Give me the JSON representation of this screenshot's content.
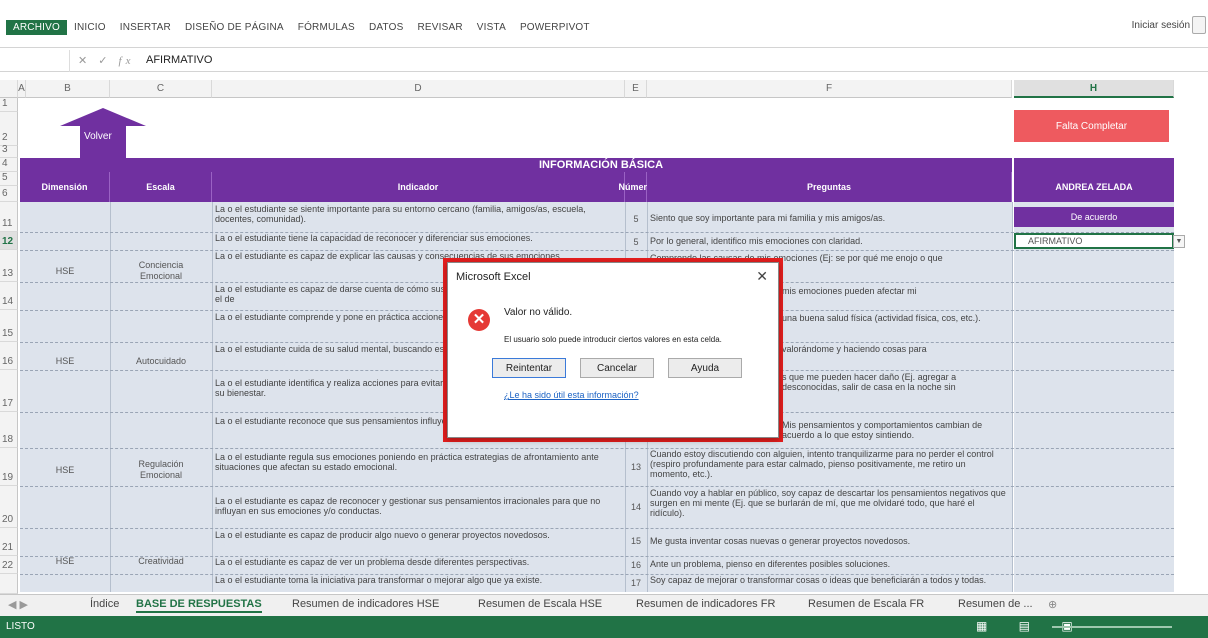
{
  "ribbon": {
    "tabs": [
      "ARCHIVO",
      "INICIO",
      "INSERTAR",
      "DISEÑO DE PÁGINA",
      "FÓRMULAS",
      "DATOS",
      "REVISAR",
      "VISTA",
      "POWERPIVOT"
    ],
    "signin": "Iniciar sesión"
  },
  "formula_bar": {
    "fx": "fx",
    "value": "AFIRMATIVO"
  },
  "columns": [
    "A",
    "B",
    "C",
    "D",
    "E",
    "F",
    "H"
  ],
  "rows": [
    "1",
    "2",
    "3",
    "4",
    "5",
    "6",
    "11",
    "12",
    "13",
    "14",
    "15",
    "16",
    "17",
    "18",
    "19",
    "20",
    "21",
    "22"
  ],
  "back_button": "Volver",
  "falta_completar": "Falta Completar",
  "info_title": "INFORMACIÓN BÁSICA",
  "headers": {
    "dimension": "Dimensión",
    "escala": "Escala",
    "indicador": "Indicador",
    "numero": "Número",
    "preguntas": "Preguntas",
    "student": "ANDREA ZELADA"
  },
  "groups": [
    {
      "dimension": "HSE",
      "escala": "Conciencia Emocional"
    },
    {
      "dimension": "HSE",
      "escala": "Autocuidado"
    },
    {
      "dimension": "HSE",
      "escala": "Regulación Emocional"
    },
    {
      "dimension": "HSE",
      "escala": "Creatividad"
    }
  ],
  "rows_data": [
    {
      "indicador": "La o el estudiante se siente importante para su entorno cercano (familia, amigos/as, escuela, docentes, comunidad).",
      "numero": "5",
      "pregunta": "Siento que soy importante para mi familia y mis amigos/as."
    },
    {
      "indicador": "La o el estudiante tiene la capacidad de reconocer y diferenciar sus emociones.",
      "numero": "5",
      "pregunta": "Por lo general, identifico mis emociones con claridad."
    },
    {
      "indicador": "La o el estudiante es capaz de explicar las causas y consecuencias de sus emociones.",
      "numero": "",
      "pregunta": "Comprendo las causas de mis emociones (Ej: se por qué me enojo o que"
    },
    {
      "indicador": "La o el estudiante es capaz de darse cuenta de cómo sus emociones afectan su bienestar personal y el de",
      "numero": "",
      "pregunta": "mis emociones pueden afectar mi"
    },
    {
      "indicador": "La o el estudiante comprende y pone en práctica acciones para tener una adecuada salud física.",
      "numero": "",
      "pregunta": "una buena salud física (actividad física, cos, etc.)."
    },
    {
      "indicador": "La o el estudiante cuida de su salud mental, buscando estar bien consigo mismo/a.",
      "numero": "",
      "pregunta": "valorándome y haciendo cosas para"
    },
    {
      "indicador": "La o el estudiante identifica y realiza acciones para evitar situaciones de riesgo que pueden afectar su bienestar.",
      "numero": "",
      "pregunta": "s que me pueden hacer daño (Ej. agregar a desconocidas, salir de casa en la noche sin"
    },
    {
      "indicador": "La o el estudiante reconoce que sus pensamientos influyen en sus emociones.",
      "numero": "12",
      "pregunta": "Mis pensamientos y comportamientos cambian de acuerdo a lo que estoy sintiendo."
    },
    {
      "indicador": "La o el estudiante regula sus emociones poniendo en práctica estrategias de afrontamiento ante situaciones que afectan su estado emocional.",
      "numero": "13",
      "pregunta": "Cuando estoy discutiendo con alguien, intento tranquilizarme para no perder el control (respiro profundamente para estar calmado, pienso positivamente, me retiro un momento, etc.)."
    },
    {
      "indicador": "La o el estudiante es capaz de reconocer y gestionar sus pensamientos irracionales para que no influyan en sus emociones y/o conductas.",
      "numero": "14",
      "pregunta": "Cuando voy a hablar en público, soy capaz de descartar los pensamientos negativos que surgen en mi mente (Ej. que se burlarán de mí, que me olvidaré todo, que haré el ridículo)."
    },
    {
      "indicador": "La o el estudiante es capaz de producir algo nuevo o generar proyectos novedosos.",
      "numero": "15",
      "pregunta": "Me gusta inventar cosas nuevas o generar proyectos novedosos."
    },
    {
      "indicador": "La o el estudiante es capaz de ver un problema desde diferentes perspectivas.",
      "numero": "16",
      "pregunta": "Ante un problema, pienso en diferentes posibles soluciones."
    },
    {
      "indicador": "La o el estudiante toma la iniciativa para transformar o mejorar algo que ya existe.",
      "numero": "17",
      "pregunta": "Soy capaz de mejorar o transformar cosas o ideas que beneficiarán a todos y todas."
    }
  ],
  "h_column": {
    "de_acuerdo": "De acuerdo",
    "active_value": "AFIRMATIVO"
  },
  "sheet_tabs": [
    "Índice",
    "BASE DE RESPUESTAS",
    "Resumen de indicadores HSE",
    "Resumen de Escala HSE",
    "Resumen de indicadores FR",
    "Resumen de Escala FR",
    "Resumen de ..."
  ],
  "status": "LISTO",
  "dialog": {
    "title": "Microsoft Excel",
    "message": "Valor no válido.",
    "detail": "El usuario solo puede introducir ciertos valores en esta celda.",
    "buttons": [
      "Reintentar",
      "Cancelar",
      "Ayuda"
    ],
    "link": "¿Le ha sido útil esta información?"
  },
  "colors": {
    "accent": "#217346",
    "purple": "#7030a0",
    "alert": "#ee5a5f",
    "frame": "#e41e1e"
  }
}
